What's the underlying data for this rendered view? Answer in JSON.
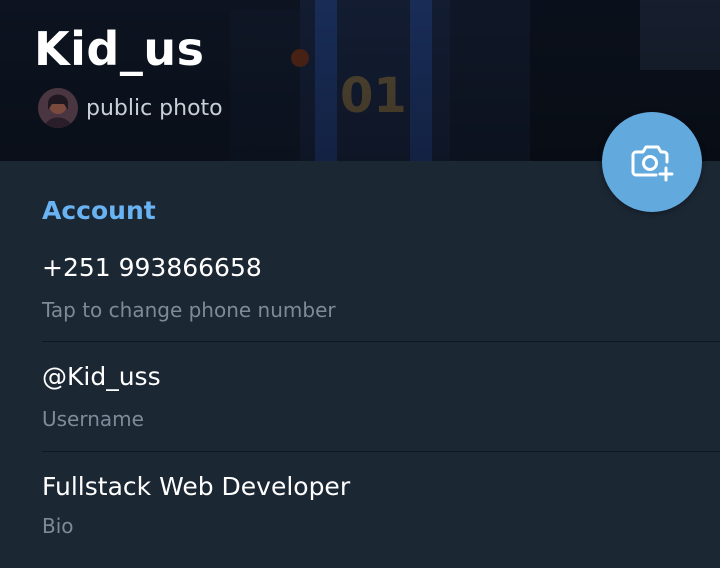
{
  "profile": {
    "name": "Kid_us",
    "status": "public photo",
    "avatar_icon": "avatar-photo"
  },
  "fab": {
    "icon": "add-photo-camera-icon",
    "color": "#62a9de"
  },
  "account": {
    "section_title": "Account",
    "phone": {
      "value": "+251 993866658",
      "caption": "Tap to change phone number"
    },
    "username": {
      "value": "@Kid_uss",
      "caption": "Username"
    },
    "bio": {
      "value": "Fullstack Web Developer",
      "caption": "Bio"
    }
  },
  "colors": {
    "background": "#1c2734",
    "accent": "#6ab3f3",
    "caption": "#7d8b99"
  }
}
